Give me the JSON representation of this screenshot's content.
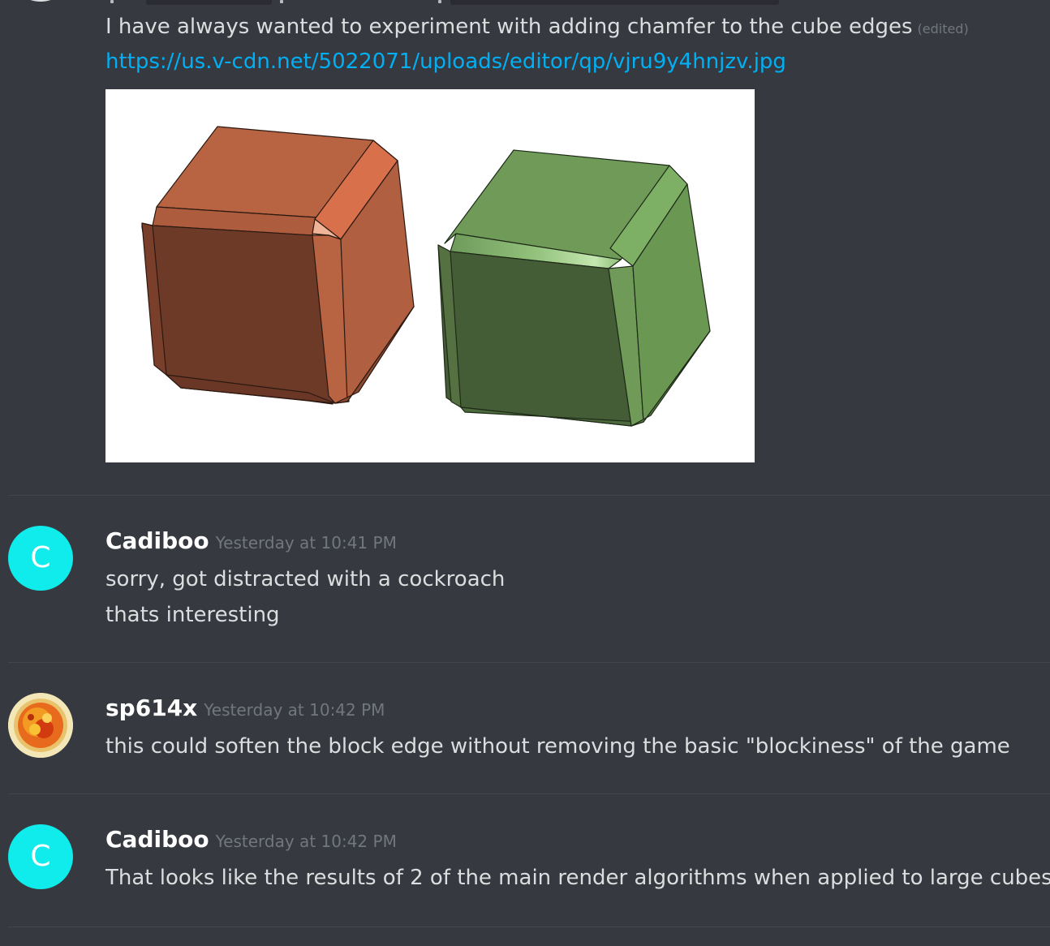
{
  "colors": {
    "background": "#36393f",
    "text": "#dcddde",
    "link": "#00b0f4",
    "muted": "#72767d",
    "divider": "#42454a",
    "avatar_c": "#10ecec"
  },
  "first_message": {
    "text": "I have always wanted to experiment with adding chamfer to the cube edges",
    "edited_label": "(edited)",
    "link_text": "https://us.v-cdn.net/5022071/uploads/editor/qp/vjru9y4hnjzv.jpg",
    "image_alt": "chamfered cubes"
  },
  "messages": [
    {
      "username": "Cadiboo",
      "timestamp": "Yesterday at 10:41 PM",
      "avatar_letter": "C",
      "lines": [
        "sorry, got distracted with a cockroach",
        "thats interesting"
      ]
    },
    {
      "username": "sp614x",
      "timestamp": "Yesterday at 10:42 PM",
      "avatar_icon": "sun-avatar-icon",
      "lines": [
        "this could soften the block edge without removing the basic \"blockiness\" of the game"
      ]
    },
    {
      "username": "Cadiboo",
      "timestamp": "Yesterday at 10:42 PM",
      "avatar_letter": "C",
      "lines": [
        "That looks like the results of 2 of the main render algorithms when applied to large cubes"
      ]
    }
  ]
}
